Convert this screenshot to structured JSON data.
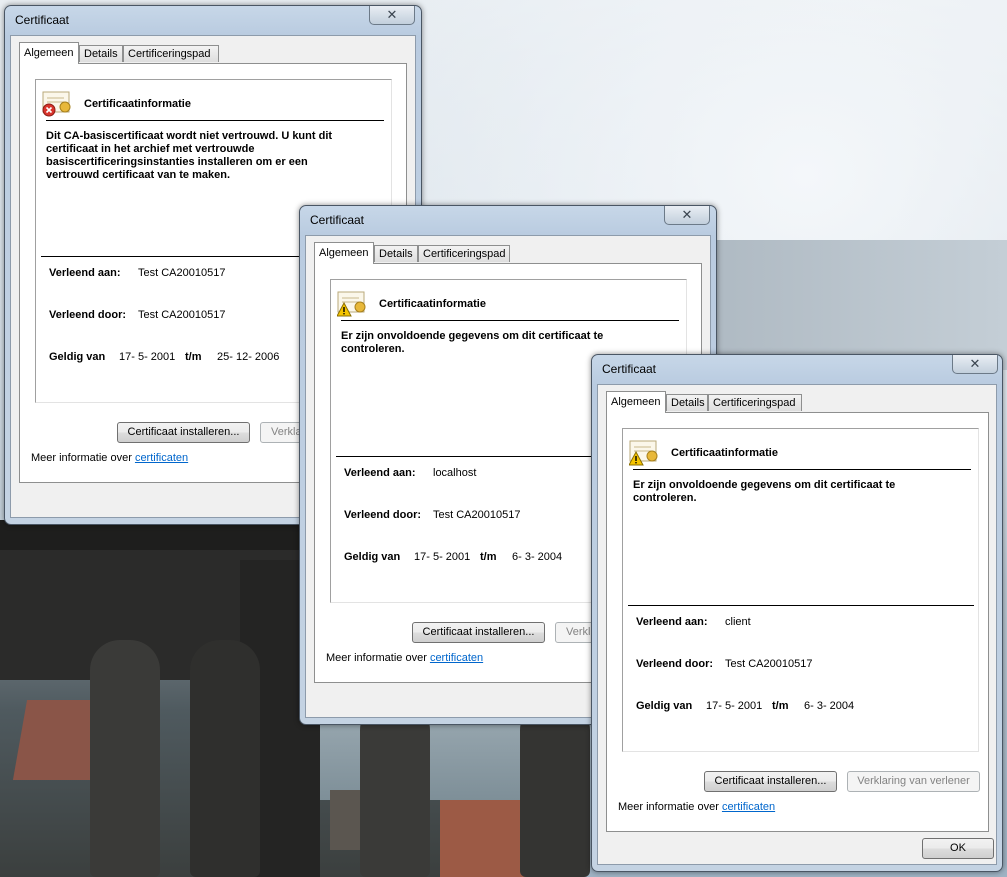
{
  "windows": [
    {
      "title": "Certificaat",
      "close_glyph": "✕",
      "tabs": [
        "Algemeen",
        "Details",
        "Certificeringspad"
      ],
      "icon": "certificate-error-icon",
      "info_title": "Certificaatinformatie",
      "message": "Dit CA-basiscertificaat wordt niet vertrouwd. U kunt dit certificaat in het archief met vertrouwde basiscertificeringsinstanties installeren om er een vertrouwd certificaat van te maken.",
      "issued_to_label": "Verleend aan:",
      "issued_to": "Test CA20010517",
      "issued_by_label": "Verleend door:",
      "issued_by": "Test CA20010517",
      "valid_from_label": "Geldig van",
      "valid_from": "17- 5- 2001",
      "valid_to_label": "t/m",
      "valid_to": "25- 12- 2006",
      "install_button": "Certificaat installeren...",
      "issuer_statement_button": "Verkla",
      "more_info_prefix": "Meer informatie over",
      "more_info_link": "certificaten"
    },
    {
      "title": "Certificaat",
      "close_glyph": "✕",
      "tabs": [
        "Algemeen",
        "Details",
        "Certificeringspad"
      ],
      "icon": "certificate-warning-icon",
      "info_title": "Certificaatinformatie",
      "message": "Er zijn onvoldoende gegevens om dit certificaat te controleren.",
      "issued_to_label": "Verleend aan:",
      "issued_to": "localhost",
      "issued_by_label": "Verleend door:",
      "issued_by": "Test CA20010517",
      "valid_from_label": "Geldig van",
      "valid_from": "17- 5- 2001",
      "valid_to_label": "t/m",
      "valid_to": "6- 3- 2004",
      "install_button": "Certificaat installeren...",
      "issuer_statement_button": "Verkla",
      "more_info_prefix": "Meer informatie over",
      "more_info_link": "certificaten"
    },
    {
      "title": "Certificaat",
      "close_glyph": "✕",
      "tabs": [
        "Algemeen",
        "Details",
        "Certificeringspad"
      ],
      "icon": "certificate-warning-icon",
      "info_title": "Certificaatinformatie",
      "message": "Er zijn onvoldoende gegevens om dit certificaat te controleren.",
      "issued_to_label": "Verleend aan:",
      "issued_to": "client",
      "issued_by_label": "Verleend door:",
      "issued_by": "Test CA20010517",
      "valid_from_label": "Geldig van",
      "valid_from": "17- 5- 2001",
      "valid_to_label": "t/m",
      "valid_to": "6- 3- 2004",
      "install_button": "Certificaat installeren...",
      "issuer_statement_button": "Verklaring van verlener",
      "more_info_prefix": "Meer informatie over",
      "more_info_link": "certificaten",
      "ok_button": "OK"
    }
  ],
  "colors": {
    "link": "#0066cc",
    "window_frame": "#c4d3e3",
    "error_red": "#d8342b",
    "warning_yellow": "#f5c400"
  }
}
